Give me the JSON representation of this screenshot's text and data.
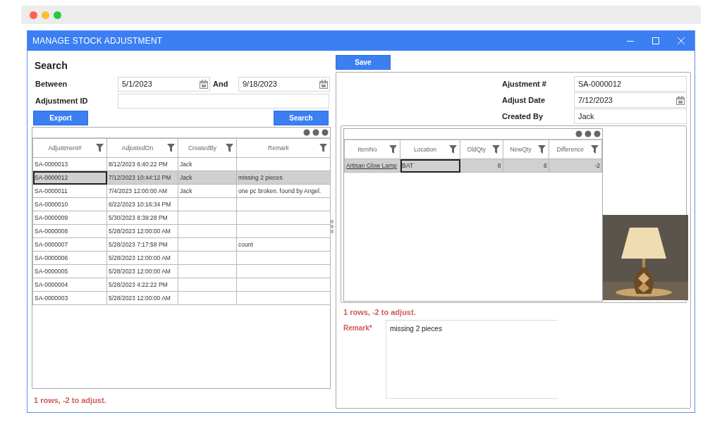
{
  "window": {
    "title": "MANAGE STOCK ADJUSTMENT"
  },
  "search": {
    "heading": "Search",
    "between_label": "Between",
    "from_date": "5/1/2023",
    "and_label": "And",
    "to_date": "9/18/2023",
    "id_label": "Adjustment ID",
    "export_button": "Export",
    "search_button": "Search"
  },
  "list": {
    "columns": [
      "Adjustment#",
      "AdjustedOn",
      "CreatedBy",
      "Remark"
    ],
    "rows": [
      {
        "cells": [
          "SA-0000013",
          "8/12/2023 6:40:22 PM",
          "Jack",
          ""
        ],
        "selected": false
      },
      {
        "cells": [
          "SA-0000012",
          "7/12/2023 10:44:12 PM",
          "Jack",
          "missing 2 pieces"
        ],
        "selected": true
      },
      {
        "cells": [
          "SA-0000011",
          "7/4/2023 12:00:00 AM",
          "Jack",
          "one pc broken.  found by Angel."
        ],
        "selected": false
      },
      {
        "cells": [
          "SA-0000010",
          "6/22/2023 10:16:34 PM",
          "",
          ""
        ],
        "selected": false
      },
      {
        "cells": [
          "SA-0000009",
          "5/30/2023 8:39:28 PM",
          "",
          ""
        ],
        "selected": false
      },
      {
        "cells": [
          "SA-0000008",
          "5/28/2023 12:00:00 AM",
          "",
          ""
        ],
        "selected": false
      },
      {
        "cells": [
          "SA-0000007",
          "5/28/2023 7:17:58 PM",
          "",
          "count"
        ],
        "selected": false
      },
      {
        "cells": [
          "SA-0000006",
          "5/28/2023 12:00:00 AM",
          "",
          ""
        ],
        "selected": false
      },
      {
        "cells": [
          "SA-0000005",
          "5/28/2023 12:00:00 AM",
          "",
          ""
        ],
        "selected": false
      },
      {
        "cells": [
          "SA-0000004",
          "5/28/2023 4:22:22 PM",
          "",
          ""
        ],
        "selected": false
      },
      {
        "cells": [
          "SA-0000003",
          "5/28/2023 12:00:00 AM",
          "",
          ""
        ],
        "selected": false
      }
    ],
    "summary": "1 rows, -2 to adjust."
  },
  "detail": {
    "save_button": "Save",
    "fields": [
      {
        "label": "Ajustment #",
        "value": "SA-0000012",
        "kind": "text"
      },
      {
        "label": "Adjust Date",
        "value": "7/12/2023",
        "kind": "date"
      },
      {
        "label": "Created By",
        "value": "Jack",
        "kind": "text"
      }
    ],
    "items": {
      "columns": [
        "ItemNo",
        "Location",
        "OldQty",
        "NewQty",
        "Difference"
      ],
      "rows": [
        {
          "cells": [
            "Artisan Glow Lamp",
            "BAT",
            "8",
            "6",
            "-2"
          ],
          "selected": true
        }
      ]
    },
    "summary": "1 rows, -2 to adjust.",
    "remark_label": "Remark*",
    "remark": "missing 2 pieces"
  }
}
